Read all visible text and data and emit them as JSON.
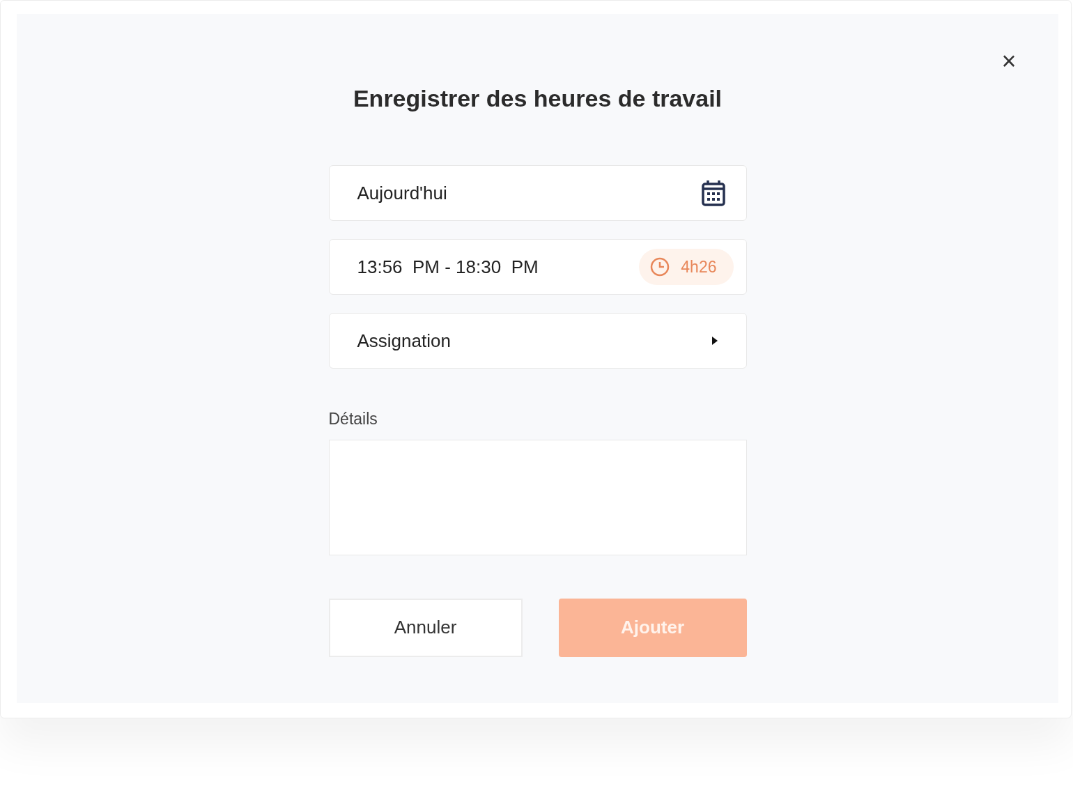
{
  "dialog": {
    "title": "Enregistrer des heures de travail",
    "close": "×"
  },
  "date_field": {
    "value": "Aujourd'hui"
  },
  "time_field": {
    "value": "13:56  PM - 18:30  PM",
    "duration": "4h26"
  },
  "assignment_field": {
    "value": "Assignation"
  },
  "details": {
    "label": "Détails"
  },
  "buttons": [
    {
      "label": "Annuler",
      "kind": "secondary",
      "disabled": false
    },
    {
      "label": "Ajouter",
      "kind": "primary",
      "disabled": true
    }
  ]
}
